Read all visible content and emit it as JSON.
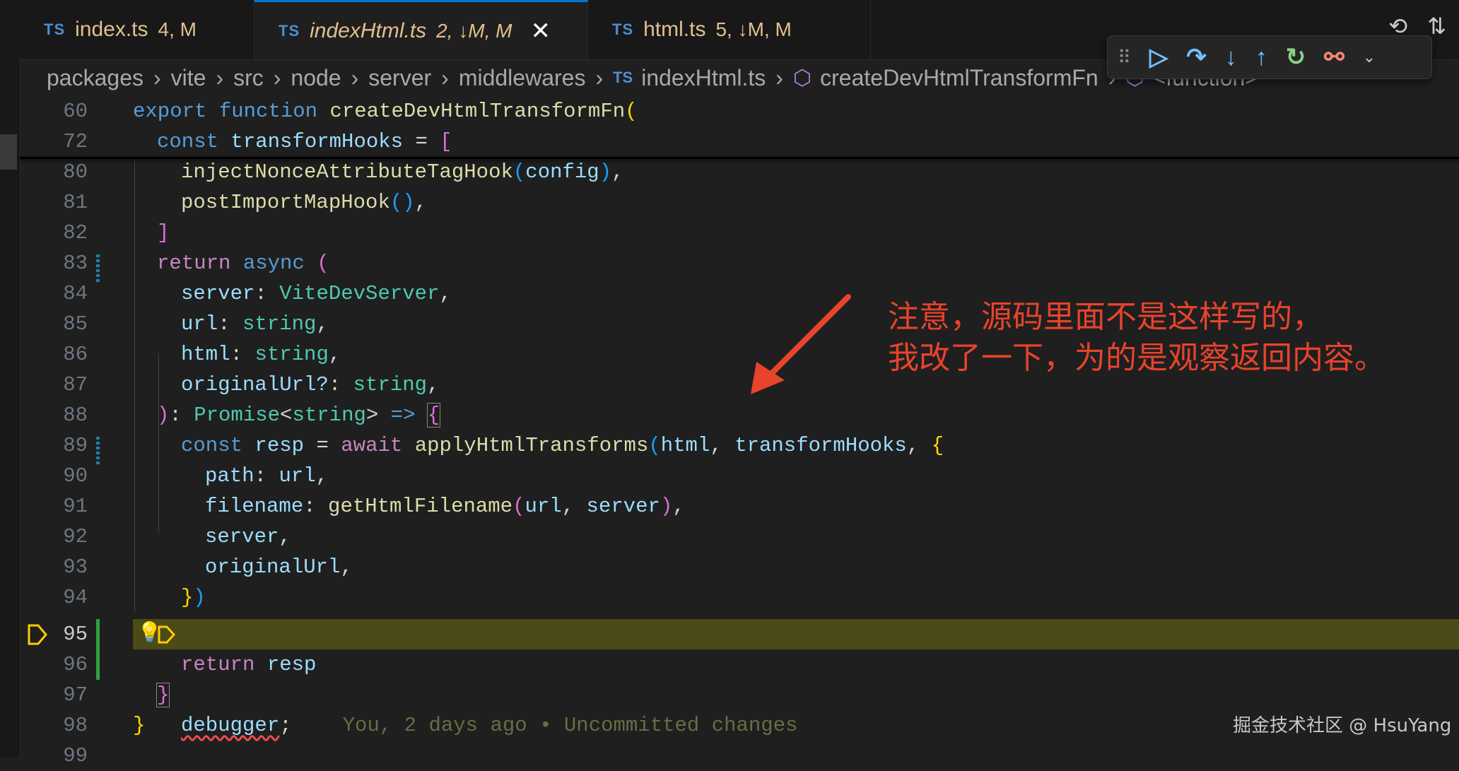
{
  "tabs": [
    {
      "icon": "TS",
      "name": "index.ts",
      "meta": "4, M"
    },
    {
      "icon": "TS",
      "name": "indexHtml.ts",
      "meta": "2, ↓M, M",
      "active": true
    },
    {
      "icon": "TS",
      "name": "html.ts",
      "meta": "5, ↓M, M"
    }
  ],
  "breadcrumb": [
    "packages",
    "vite",
    "src",
    "node",
    "server",
    "middlewares",
    "indexHtml.ts",
    "createDevHtmlTransformFn",
    "<function>"
  ],
  "breadcrumb_icon": "TS",
  "gutter": [
    "60",
    "72",
    "80",
    "81",
    "82",
    "83",
    "84",
    "85",
    "86",
    "87",
    "88",
    "89",
    "90",
    "91",
    "92",
    "93",
    "94",
    "95",
    "96",
    "97",
    "98",
    "99"
  ],
  "code": {
    "l60": {
      "a": "export",
      "b": "function",
      "c": "createDevHtmlTransformFn",
      "d": "("
    },
    "l72": {
      "a": "const",
      "b": "transformHooks",
      "c": " = ",
      "d": "["
    },
    "l80": {
      "a": "injectNonceAttributeTagHook",
      "b": "(",
      "c": "config",
      "d": ")",
      ".e": ","
    },
    "l81": {
      "a": "postImportMapHook",
      "b": "()",
      "c": ","
    },
    "l82": {
      "a": "]"
    },
    "l83": {
      "a": "return",
      "b": "async",
      "c": "("
    },
    "l84": {
      "a": "server",
      "b": ": ",
      "c": "ViteDevServer",
      "d": ","
    },
    "l85": {
      "a": "url",
      "b": ": ",
      "c": "string",
      "d": ","
    },
    "l86": {
      "a": "html",
      "b": ": ",
      "c": "string",
      "d": ","
    },
    "l87": {
      "a": "originalUrl?",
      "b": ": ",
      "c": "string",
      "d": ","
    },
    "l88": {
      "a": ")",
      "b": ": ",
      "c": "Promise",
      "d": "<",
      "e": "string",
      "f": ">",
      "g": " => ",
      "h": "{"
    },
    "l89": {
      "a": "const",
      "b": "resp",
      "c": " = ",
      "d": "await",
      "e": "applyHtmlTransforms",
      "f": "(",
      "g": "html",
      "h": ", ",
      "i": "transformHooks",
      "j": ", ",
      "k": "{"
    },
    "l90": {
      "a": "path",
      "b": ": ",
      "c": "url",
      "d": ","
    },
    "l91": {
      "a": "filename",
      "b": ": ",
      "c": "getHtmlFilename",
      "d": "(",
      "e": "url",
      "f": ", ",
      "g": "server",
      "h": ")",
      "i": ","
    },
    "l92": {
      "a": "server",
      "b": ","
    },
    "l93": {
      "a": "originalUrl",
      "b": ","
    },
    "l94": {
      "a": "}",
      "b": ")"
    },
    "l95": {
      "a": "debugger",
      "b": ";",
      "ghost": "You, 2 days ago • Uncommitted changes"
    },
    "l96": {
      "a": "return",
      "b": "resp"
    },
    "l97": {
      "a": "}"
    },
    "l98": {
      "a": "}"
    }
  },
  "annotation": {
    "line1": "注意，源码里面不是这样写的，",
    "line2": "我改了一下，为的是观察返回内容。"
  },
  "watermark": "掘金技术社区 @ HsuYang",
  "colors": {
    "accent": "#0078d4",
    "annotation": "#e8432b",
    "breakpoint": "#ffcc00",
    "highlight": "#4b4b18"
  },
  "icons": {
    "close": "close-icon",
    "history": "history-icon",
    "compare": "git-compare-icon",
    "continue": "continue-icon",
    "step_over": "step-over-icon",
    "step_into": "step-into-icon",
    "step_out": "step-out-icon",
    "restart": "restart-icon",
    "disconnect": "disconnect-icon",
    "lightbulb": "lightbulb-icon",
    "breakpoint": "breakpoint-arrow-icon",
    "symbol": "symbol-method-icon"
  }
}
